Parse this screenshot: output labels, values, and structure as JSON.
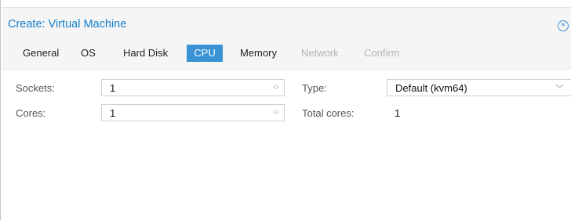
{
  "dialog": {
    "title": "Create: Virtual Machine",
    "close_icon": "close-circle-icon"
  },
  "tabs": [
    {
      "label": "General",
      "state": "enabled"
    },
    {
      "label": "OS",
      "state": "enabled"
    },
    {
      "label": "Hard Disk",
      "state": "enabled"
    },
    {
      "label": "CPU",
      "state": "active"
    },
    {
      "label": "Memory",
      "state": "enabled"
    },
    {
      "label": "Network",
      "state": "disabled"
    },
    {
      "label": "Confirm",
      "state": "disabled"
    }
  ],
  "form": {
    "sockets": {
      "label": "Sockets:",
      "value": "1"
    },
    "cores": {
      "label": "Cores:",
      "value": "1"
    },
    "type": {
      "label": "Type:",
      "value": "Default (kvm64)"
    },
    "total_cores": {
      "label": "Total cores:",
      "value": "1"
    }
  },
  "colors": {
    "title": "#157fcc",
    "active_tab": "#3892d4",
    "disabled_tab": "#b3b3b3"
  }
}
